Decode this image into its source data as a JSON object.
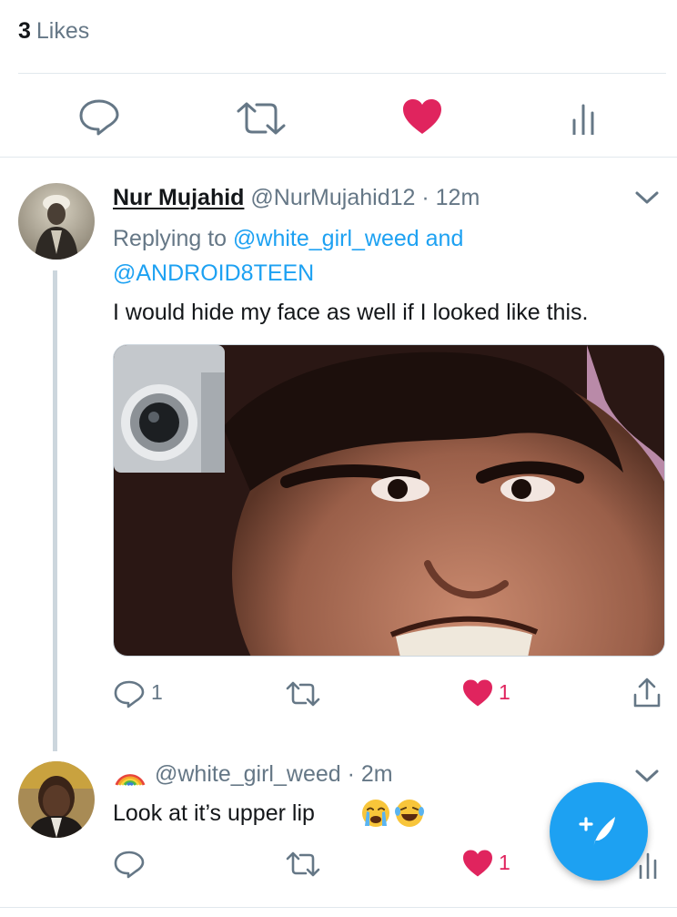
{
  "likes": {
    "count": "3",
    "label": "Likes"
  },
  "main_actions": {
    "reply_icon": "reply-icon",
    "retweet_icon": "retweet-icon",
    "like_icon": "heart-filled-icon",
    "analytics_icon": "analytics-icon"
  },
  "reply1": {
    "display_name": "Nur Mujahid",
    "handle": "@NurMujahid12",
    "separator": "·",
    "time": "12m",
    "replying_label": "Replying to",
    "replying_user1": "@white_girl_weed",
    "replying_and": "and",
    "replying_user2": "@ANDROID8TEEN",
    "text": "I would hide my face as well if I looked like this.",
    "reply_count": "1",
    "like_count": "1"
  },
  "reply2": {
    "name_emoji": "rainbow-icon",
    "handle": "@white_girl_weed",
    "separator": "·",
    "time": "2m",
    "text": "Look at it’s upper lip",
    "emojis": [
      "crying-face-icon",
      "laughing-tears-icon"
    ],
    "like_count": "1"
  },
  "compose": {
    "icon": "compose-tweet-icon"
  },
  "colors": {
    "accent": "#1da1f2",
    "like": "#e0245e",
    "secondary_text": "#657786",
    "primary_text": "#14171a",
    "divider": "#e1e8ed"
  }
}
